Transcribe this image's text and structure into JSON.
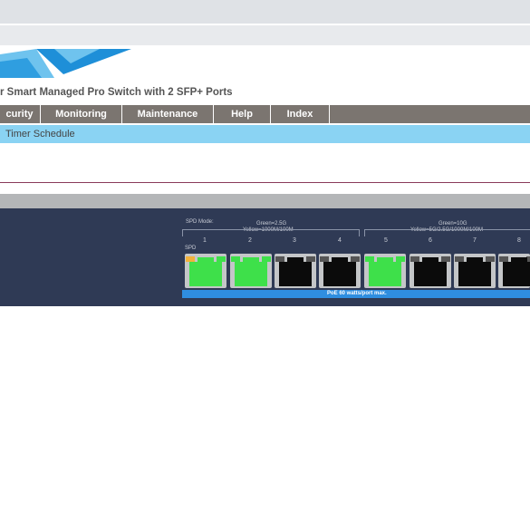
{
  "product": {
    "title": "r Smart Managed Pro Switch with 2 SFP+ Ports"
  },
  "menu": {
    "items": [
      {
        "label": "curity"
      },
      {
        "label": "Monitoring"
      },
      {
        "label": "Maintenance"
      },
      {
        "label": "Help"
      },
      {
        "label": "Index"
      }
    ]
  },
  "submenu": {
    "label": "Timer Schedule"
  },
  "switch_panel": {
    "spd_mode_label": "SPD Mode:",
    "spd_label": "SPD",
    "legend_left": {
      "line1": "Green=2.5G",
      "line2": "Yellow=1000M/100M"
    },
    "legend_right": {
      "line1": "Green=10G",
      "line2": "Yellow=5G/2.5G/1000M/100M"
    },
    "ports": [
      {
        "number": "1",
        "state": "linked",
        "led_left": "yellow",
        "led_right": "green"
      },
      {
        "number": "2",
        "state": "linked",
        "led_left": "green",
        "led_right": "green"
      },
      {
        "number": "3",
        "state": "empty",
        "led_left": "off",
        "led_right": "off"
      },
      {
        "number": "4",
        "state": "empty",
        "led_left": "off",
        "led_right": "off"
      },
      {
        "number": "5",
        "state": "linked",
        "led_left": "green",
        "led_right": "green"
      },
      {
        "number": "6",
        "state": "empty",
        "led_left": "off",
        "led_right": "off"
      },
      {
        "number": "7",
        "state": "empty",
        "led_left": "off",
        "led_right": "off"
      },
      {
        "number": "8",
        "state": "empty",
        "led_left": "off",
        "led_right": "off"
      }
    ],
    "poe_label": "PoE 60 watts/port max."
  },
  "colors": {
    "menu_bg": "#7b7570",
    "submenu_bg": "#8ad3f3",
    "panel_bg": "#2f3a55",
    "link_green": "#3ee04a",
    "link_yellow": "#f2b13b",
    "poe_blue": "#2f8ee0"
  }
}
